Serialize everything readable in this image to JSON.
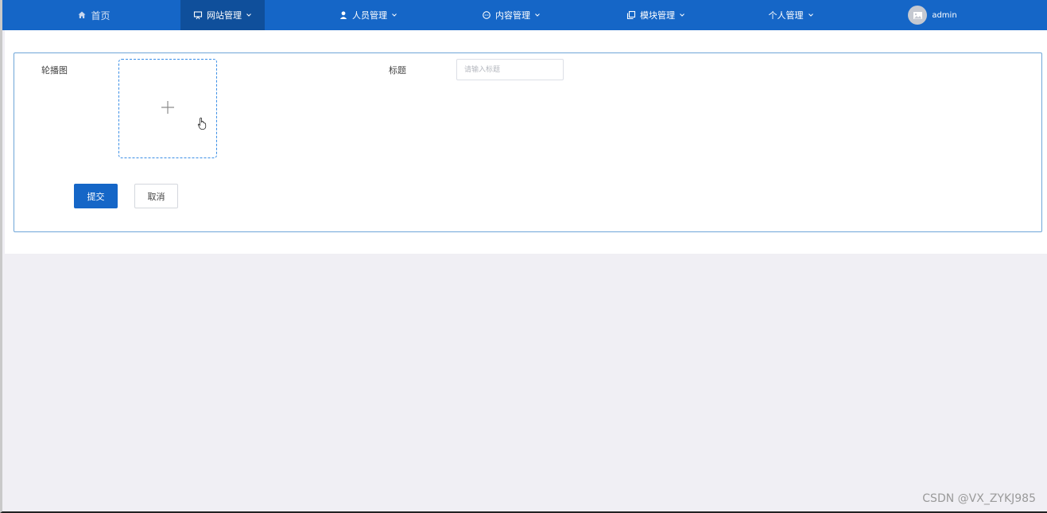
{
  "nav": {
    "home": "首页",
    "site_mgmt": "网站管理",
    "people_mgmt": "人员管理",
    "content_mgmt": "内容管理",
    "module_mgmt": "模块管理",
    "personal_mgmt": "个人管理",
    "user": "admin"
  },
  "form": {
    "carousel_label": "轮播图",
    "title_label": "标题",
    "title_placeholder": "请输入标题",
    "title_value": "",
    "submit": "提交",
    "cancel": "取消"
  },
  "watermark": "CSDN @VX_ZYKJ985",
  "colors": {
    "primary": "#1566c7",
    "nav_active": "#0f4f9b",
    "upload_border": "#3a8ee6",
    "page_bg": "#f0eff4"
  },
  "icons": {
    "home": "home-icon",
    "site": "monitor-icon",
    "people": "user-icon",
    "content": "chat-icon",
    "module": "copy-icon",
    "avatar": "image-icon",
    "upload": "plus-icon"
  }
}
